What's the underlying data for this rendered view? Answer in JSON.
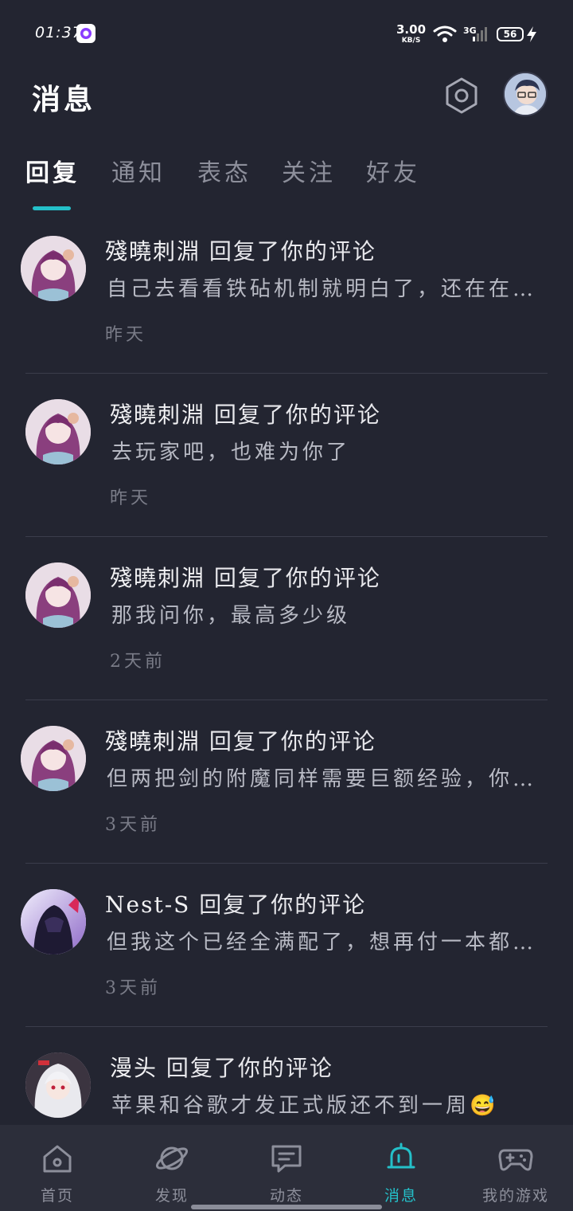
{
  "status_bar": {
    "time": "01:37",
    "net_speed_value": "3.00",
    "net_speed_unit": "KB/S",
    "network_type": "3G",
    "battery": "56"
  },
  "header": {
    "title": "消息"
  },
  "tabs": [
    {
      "label": "回复",
      "active": true
    },
    {
      "label": "通知",
      "active": false
    },
    {
      "label": "表态",
      "active": false
    },
    {
      "label": "关注",
      "active": false
    },
    {
      "label": "好友",
      "active": false
    }
  ],
  "messages": [
    {
      "user": "殘曉刺淵",
      "action": "回复了你的评论",
      "text": "自己去看看铁砧机制就明白了，还在在意这个吗",
      "time": "昨天"
    },
    {
      "user": "殘曉刺淵",
      "action": "回复了你的评论",
      "text": "去玩家吧，也难为你了",
      "time": "昨天"
    },
    {
      "user": "殘曉刺淵",
      "action": "回复了你的评论",
      "text": "那我问你，最高多少级",
      "time": "2天前"
    },
    {
      "user": "殘曉刺淵",
      "action": "回复了你的评论",
      "text": "但两把剑的附魔同样需要巨额经验，你知道吗",
      "time": "3天前"
    },
    {
      "user": "Nest-S",
      "action": "回复了你的评论",
      "text": "但我这个已经全满配了，想再付一本都不行",
      "time": "3天前"
    },
    {
      "user": "漫头",
      "action": "回复了你的评论",
      "text": "苹果和谷歌才发正式版还不到一周😅",
      "time": ""
    }
  ],
  "bottom_nav": [
    {
      "label": "首页",
      "icon": "home-icon",
      "active": false
    },
    {
      "label": "发现",
      "icon": "planet-icon",
      "active": false
    },
    {
      "label": "动态",
      "icon": "chat-bubble-icon",
      "active": false
    },
    {
      "label": "消息",
      "icon": "bell-icon",
      "active": true
    },
    {
      "label": "我的游戏",
      "icon": "gamepad-icon",
      "active": false
    }
  ],
  "colors": {
    "background": "#232531",
    "accent": "#24c0c9",
    "nav_background": "#2c2e3a"
  }
}
